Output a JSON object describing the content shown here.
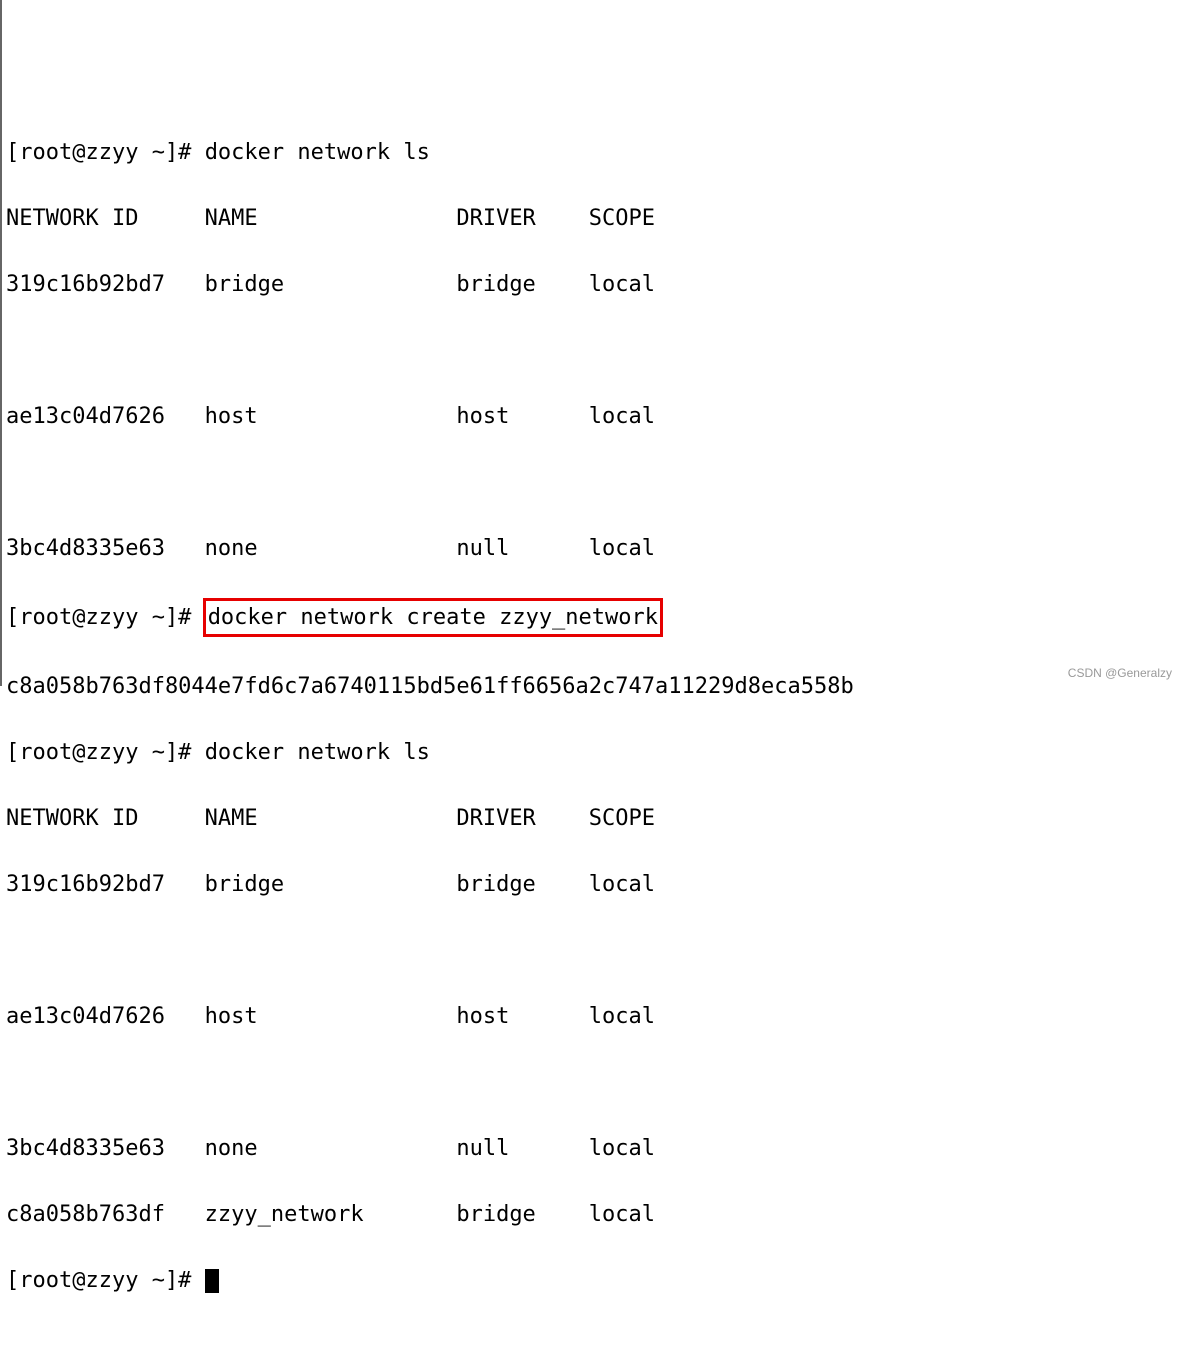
{
  "prompt": "[root@zzyy ~]# ",
  "commands": {
    "ls1": "docker network ls",
    "create": "docker network create zzyy_network",
    "ls2": "docker network ls"
  },
  "ls_header": "NETWORK ID     NAME               DRIVER    SCOPE",
  "networks1": {
    "row1": "319c16b92bd7   bridge             bridge    local",
    "row2": "ae13c04d7626   host               host      local",
    "row3": "3bc4d8335e63   none               null      local"
  },
  "create_output": "c8a058b763df8044e7fd6c7a6740115bd5e61ff6656a2c747a11229d8eca558b",
  "networks2": {
    "row1": "319c16b92bd7   bridge             bridge    local",
    "row2": "ae13c04d7626   host               host      local",
    "row3": "3bc4d8335e63   none               null      local",
    "row4": "c8a058b763df   zzyy_network       bridge    local"
  },
  "watermark": "CSDN @Generalzy"
}
